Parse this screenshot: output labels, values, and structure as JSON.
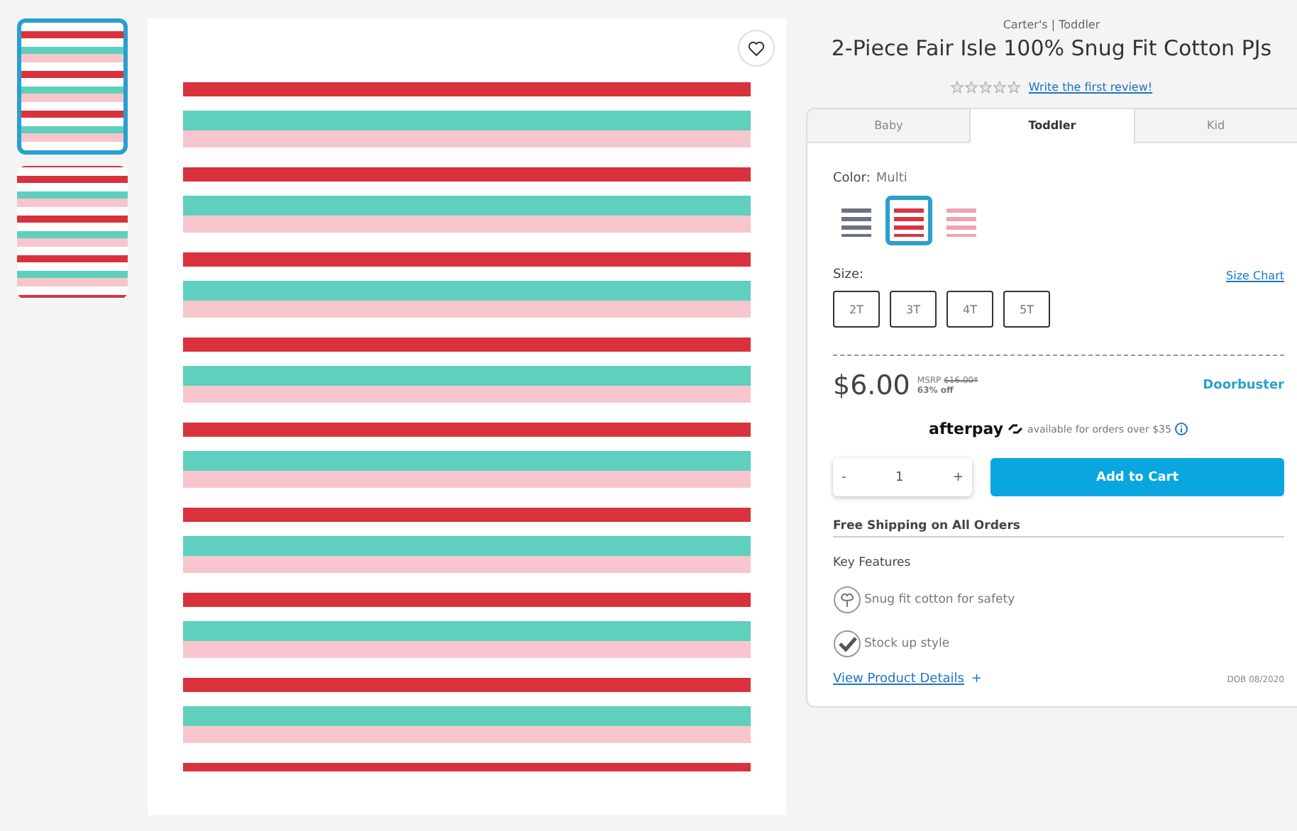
{
  "thumbnails": [
    {
      "selected": true
    },
    {
      "selected": false
    }
  ],
  "product": {
    "brand": "Carter's | Toddler",
    "title": "2-Piece Fair Isle 100% Snug Fit Cotton PJs",
    "rating": {
      "stars": 0,
      "review_link": "Write the first review!"
    }
  },
  "tabs": [
    {
      "label": "Baby",
      "selected": false
    },
    {
      "label": "Toddler",
      "selected": true
    },
    {
      "label": "Kid",
      "selected": false
    }
  ],
  "color": {
    "label": "Color:",
    "value": "Multi",
    "swatches": [
      {
        "color": "#6b7280",
        "selected": false
      },
      {
        "color": "#d9343f",
        "selected": true
      },
      {
        "color": "#f0a3ab",
        "selected": false
      }
    ]
  },
  "size": {
    "label": "Size:",
    "chart_link": "Size Chart",
    "options": [
      {
        "label": "2T",
        "selected": false
      },
      {
        "label": "3T",
        "selected": false
      },
      {
        "label": "4T",
        "selected": false
      },
      {
        "label": "5T",
        "selected": false
      }
    ]
  },
  "price": {
    "current": "$6.00",
    "msrp_label": "MSRP",
    "msrp": "$16.00*",
    "discount": "63% off",
    "badge": "Doorbuster"
  },
  "afterpay": {
    "logo": "afterpay",
    "text": "available for orders over $35"
  },
  "quantity": {
    "minus": "-",
    "value": "1",
    "plus": "+"
  },
  "add_to_cart": "Add to Cart",
  "shipping": "Free Shipping on All Orders",
  "features": {
    "title": "Key Features",
    "items": [
      {
        "kind": "cotton",
        "text": "Snug fit cotton for safety"
      },
      {
        "kind": "check",
        "text": "Stock up style"
      }
    ]
  },
  "details_link": "View Product Details",
  "details_plus": "+",
  "date_code": "DOB 08/2020"
}
